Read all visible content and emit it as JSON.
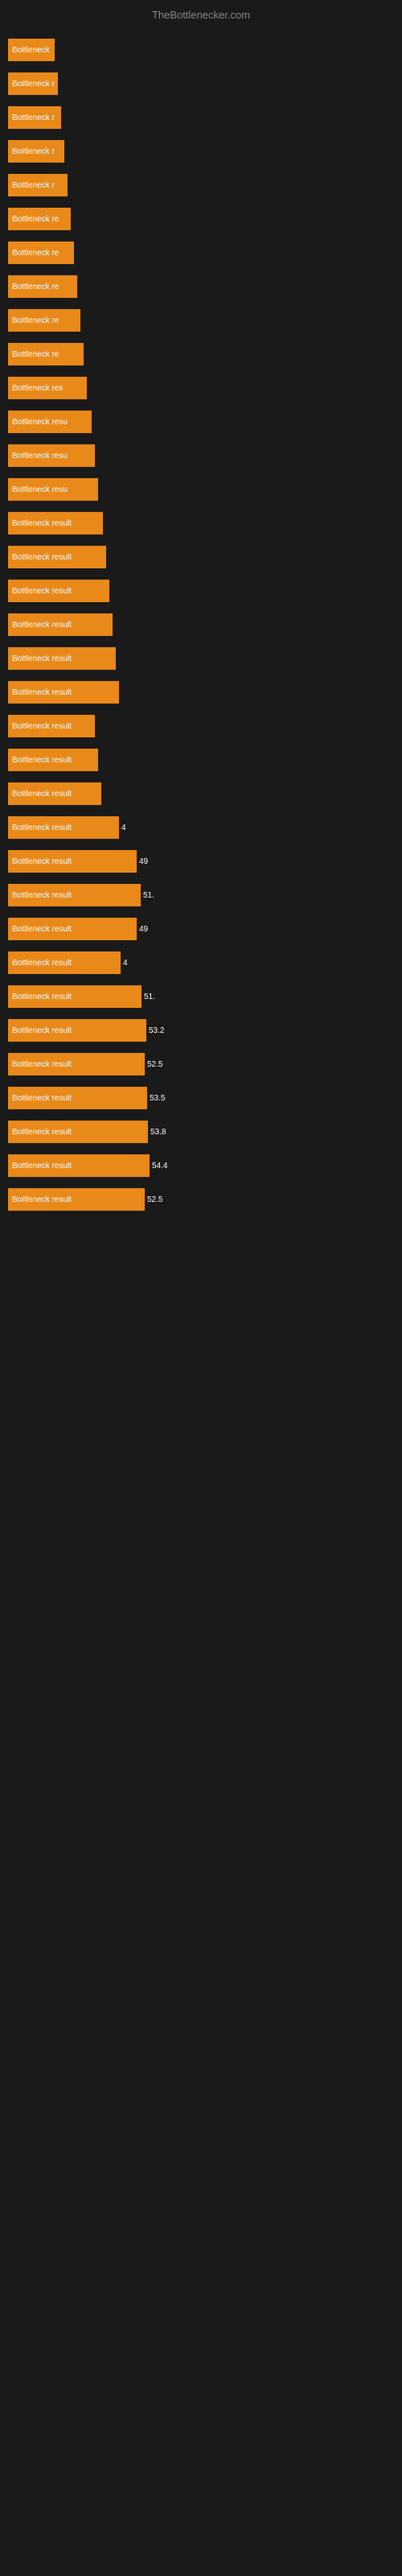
{
  "header": {
    "title": "TheBottlenecker.com"
  },
  "bars": [
    {
      "label": "Bottleneck",
      "width": 58,
      "value": ""
    },
    {
      "label": "Bottleneck r",
      "width": 62,
      "value": ""
    },
    {
      "label": "Bottleneck r",
      "width": 66,
      "value": ""
    },
    {
      "label": "Bottleneck r",
      "width": 70,
      "value": ""
    },
    {
      "label": "Bottleneck r",
      "width": 74,
      "value": ""
    },
    {
      "label": "Bottleneck re",
      "width": 78,
      "value": ""
    },
    {
      "label": "Bottleneck re",
      "width": 82,
      "value": ""
    },
    {
      "label": "Bottleneck re",
      "width": 86,
      "value": ""
    },
    {
      "label": "Bottleneck re",
      "width": 90,
      "value": ""
    },
    {
      "label": "Bottleneck re",
      "width": 94,
      "value": ""
    },
    {
      "label": "Bottleneck res",
      "width": 98,
      "value": ""
    },
    {
      "label": "Bottleneck resu",
      "width": 104,
      "value": ""
    },
    {
      "label": "Bottleneck resu",
      "width": 108,
      "value": ""
    },
    {
      "label": "Bottleneck resu",
      "width": 112,
      "value": ""
    },
    {
      "label": "Bottleneck result",
      "width": 118,
      "value": ""
    },
    {
      "label": "Bottleneck result",
      "width": 122,
      "value": ""
    },
    {
      "label": "Bottleneck result",
      "width": 126,
      "value": ""
    },
    {
      "label": "Bottleneck result",
      "width": 130,
      "value": ""
    },
    {
      "label": "Bottleneck result",
      "width": 134,
      "value": ""
    },
    {
      "label": "Bottleneck result",
      "width": 138,
      "value": ""
    },
    {
      "label": "Bottleneck result",
      "width": 108,
      "value": ""
    },
    {
      "label": "Bottleneck result",
      "width": 112,
      "value": ""
    },
    {
      "label": "Bottleneck result",
      "width": 116,
      "value": ""
    },
    {
      "label": "Bottleneck result",
      "width": 138,
      "value": "4"
    },
    {
      "label": "Bottleneck result",
      "width": 160,
      "value": "49"
    },
    {
      "label": "Bottleneck result",
      "width": 165,
      "value": "51."
    },
    {
      "label": "Bottleneck result",
      "width": 160,
      "value": "49"
    },
    {
      "label": "Bottleneck result",
      "width": 140,
      "value": "4"
    },
    {
      "label": "Bottleneck result",
      "width": 166,
      "value": "51."
    },
    {
      "label": "Bottleneck result",
      "width": 172,
      "value": "53.2"
    },
    {
      "label": "Bottleneck result",
      "width": 170,
      "value": "52.5"
    },
    {
      "label": "Bottleneck result",
      "width": 173,
      "value": "53.5"
    },
    {
      "label": "Bottleneck result",
      "width": 174,
      "value": "53.8"
    },
    {
      "label": "Bottleneck result",
      "width": 176,
      "value": "54.4"
    },
    {
      "label": "Bottleneck result",
      "width": 170,
      "value": "52.5"
    }
  ]
}
